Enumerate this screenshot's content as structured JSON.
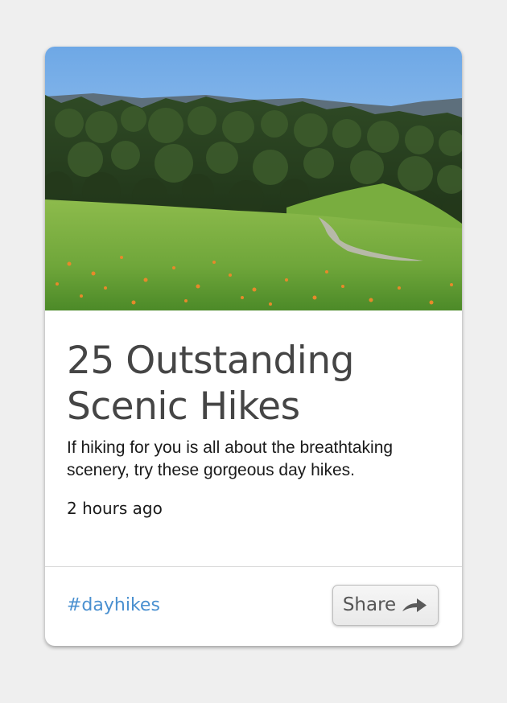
{
  "card": {
    "image_alt": "Green hillside meadow with orange wildflowers and a dirt trail",
    "title": "25 Outstanding Scenic Hikes",
    "description": "If hiking for you is all about the breathtaking scenery, try these gorgeous day hikes.",
    "time": "2 hours ago",
    "tag": "#dayhikes",
    "share_label": "Share",
    "share_icon": "right-arrow-icon"
  },
  "colors": {
    "background": "#efefef",
    "card": "#ffffff",
    "title": "#454545",
    "tag_link": "#4a90d0",
    "button_text": "#555555"
  }
}
